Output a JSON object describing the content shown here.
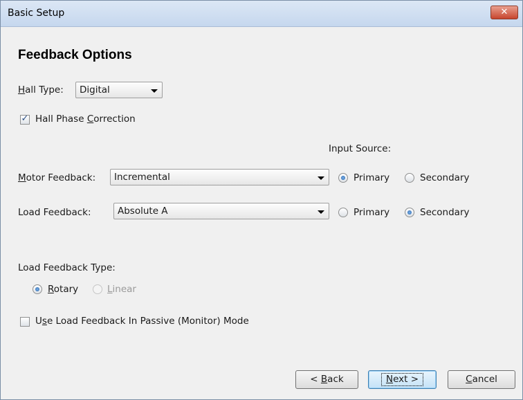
{
  "window": {
    "title": "Basic Setup",
    "close_glyph": "✕"
  },
  "heading": "Feedback Options",
  "hall_type": {
    "label_accel": "H",
    "label_rest": "all Type:",
    "value": "Digital"
  },
  "hall_phase_correction": {
    "label_pre": "Hall Phase ",
    "label_accel": "C",
    "label_rest": "orrection",
    "checked": true,
    "check_glyph": "✓"
  },
  "input_source_label": "Input Source:",
  "motor_feedback": {
    "label_accel": "M",
    "label_rest": "otor Feedback:",
    "value": "Incremental",
    "primary_label": "Primary",
    "secondary_label": "Secondary",
    "selected": "Primary"
  },
  "load_feedback": {
    "label": "Load Feedback:",
    "value": "Absolute A",
    "primary_label": "Primary",
    "secondary_label": "Secondary",
    "selected": "Secondary"
  },
  "load_feedback_type": {
    "label": "Load Feedback Type:",
    "rotary_accel": "R",
    "rotary_rest": "otary",
    "linear_accel": "L",
    "linear_rest": "inear",
    "selected": "Rotary",
    "linear_enabled": false
  },
  "passive_mode": {
    "label_pre": "U",
    "label_accel": "s",
    "label_rest": "e Load Feedback In Passive (Monitor) Mode",
    "checked": false
  },
  "buttons": {
    "back_pre": "< ",
    "back_accel": "B",
    "back_rest": "ack",
    "next_accel": "N",
    "next_rest": "ext >",
    "cancel_accel": "C",
    "cancel_rest": "ancel"
  },
  "colors": {
    "accent": "#1f5fa8",
    "window_bg": "#f0f0f0",
    "titlebar": "#c5d7ee"
  }
}
